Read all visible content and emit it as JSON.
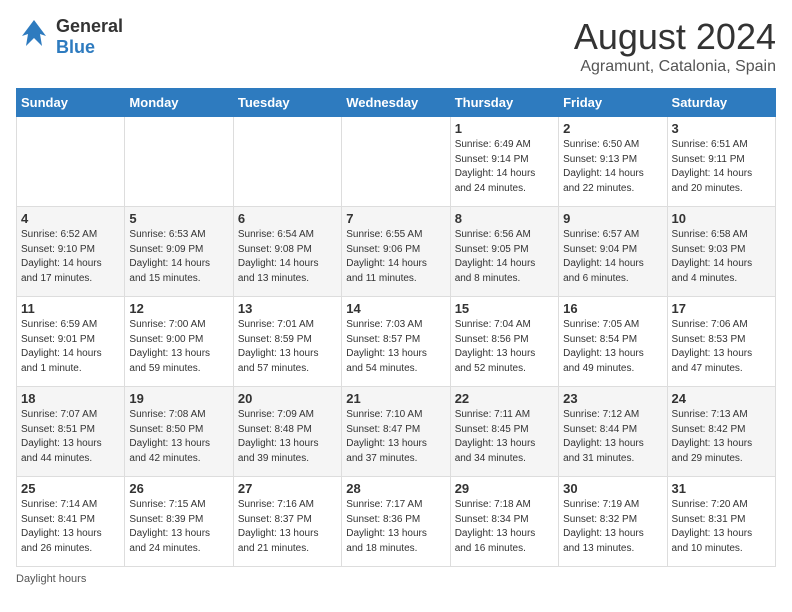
{
  "header": {
    "logo_general": "General",
    "logo_blue": "Blue",
    "title": "August 2024",
    "subtitle": "Agramunt, Catalonia, Spain"
  },
  "calendar": {
    "days_of_week": [
      "Sunday",
      "Monday",
      "Tuesday",
      "Wednesday",
      "Thursday",
      "Friday",
      "Saturday"
    ],
    "weeks": [
      [
        {
          "day": "",
          "info": ""
        },
        {
          "day": "",
          "info": ""
        },
        {
          "day": "",
          "info": ""
        },
        {
          "day": "",
          "info": ""
        },
        {
          "day": "1",
          "info": "Sunrise: 6:49 AM\nSunset: 9:14 PM\nDaylight: 14 hours\nand 24 minutes."
        },
        {
          "day": "2",
          "info": "Sunrise: 6:50 AM\nSunset: 9:13 PM\nDaylight: 14 hours\nand 22 minutes."
        },
        {
          "day": "3",
          "info": "Sunrise: 6:51 AM\nSunset: 9:11 PM\nDaylight: 14 hours\nand 20 minutes."
        }
      ],
      [
        {
          "day": "4",
          "info": "Sunrise: 6:52 AM\nSunset: 9:10 PM\nDaylight: 14 hours\nand 17 minutes."
        },
        {
          "day": "5",
          "info": "Sunrise: 6:53 AM\nSunset: 9:09 PM\nDaylight: 14 hours\nand 15 minutes."
        },
        {
          "day": "6",
          "info": "Sunrise: 6:54 AM\nSunset: 9:08 PM\nDaylight: 14 hours\nand 13 minutes."
        },
        {
          "day": "7",
          "info": "Sunrise: 6:55 AM\nSunset: 9:06 PM\nDaylight: 14 hours\nand 11 minutes."
        },
        {
          "day": "8",
          "info": "Sunrise: 6:56 AM\nSunset: 9:05 PM\nDaylight: 14 hours\nand 8 minutes."
        },
        {
          "day": "9",
          "info": "Sunrise: 6:57 AM\nSunset: 9:04 PM\nDaylight: 14 hours\nand 6 minutes."
        },
        {
          "day": "10",
          "info": "Sunrise: 6:58 AM\nSunset: 9:03 PM\nDaylight: 14 hours\nand 4 minutes."
        }
      ],
      [
        {
          "day": "11",
          "info": "Sunrise: 6:59 AM\nSunset: 9:01 PM\nDaylight: 14 hours\nand 1 minute."
        },
        {
          "day": "12",
          "info": "Sunrise: 7:00 AM\nSunset: 9:00 PM\nDaylight: 13 hours\nand 59 minutes."
        },
        {
          "day": "13",
          "info": "Sunrise: 7:01 AM\nSunset: 8:59 PM\nDaylight: 13 hours\nand 57 minutes."
        },
        {
          "day": "14",
          "info": "Sunrise: 7:03 AM\nSunset: 8:57 PM\nDaylight: 13 hours\nand 54 minutes."
        },
        {
          "day": "15",
          "info": "Sunrise: 7:04 AM\nSunset: 8:56 PM\nDaylight: 13 hours\nand 52 minutes."
        },
        {
          "day": "16",
          "info": "Sunrise: 7:05 AM\nSunset: 8:54 PM\nDaylight: 13 hours\nand 49 minutes."
        },
        {
          "day": "17",
          "info": "Sunrise: 7:06 AM\nSunset: 8:53 PM\nDaylight: 13 hours\nand 47 minutes."
        }
      ],
      [
        {
          "day": "18",
          "info": "Sunrise: 7:07 AM\nSunset: 8:51 PM\nDaylight: 13 hours\nand 44 minutes."
        },
        {
          "day": "19",
          "info": "Sunrise: 7:08 AM\nSunset: 8:50 PM\nDaylight: 13 hours\nand 42 minutes."
        },
        {
          "day": "20",
          "info": "Sunrise: 7:09 AM\nSunset: 8:48 PM\nDaylight: 13 hours\nand 39 minutes."
        },
        {
          "day": "21",
          "info": "Sunrise: 7:10 AM\nSunset: 8:47 PM\nDaylight: 13 hours\nand 37 minutes."
        },
        {
          "day": "22",
          "info": "Sunrise: 7:11 AM\nSunset: 8:45 PM\nDaylight: 13 hours\nand 34 minutes."
        },
        {
          "day": "23",
          "info": "Sunrise: 7:12 AM\nSunset: 8:44 PM\nDaylight: 13 hours\nand 31 minutes."
        },
        {
          "day": "24",
          "info": "Sunrise: 7:13 AM\nSunset: 8:42 PM\nDaylight: 13 hours\nand 29 minutes."
        }
      ],
      [
        {
          "day": "25",
          "info": "Sunrise: 7:14 AM\nSunset: 8:41 PM\nDaylight: 13 hours\nand 26 minutes."
        },
        {
          "day": "26",
          "info": "Sunrise: 7:15 AM\nSunset: 8:39 PM\nDaylight: 13 hours\nand 24 minutes."
        },
        {
          "day": "27",
          "info": "Sunrise: 7:16 AM\nSunset: 8:37 PM\nDaylight: 13 hours\nand 21 minutes."
        },
        {
          "day": "28",
          "info": "Sunrise: 7:17 AM\nSunset: 8:36 PM\nDaylight: 13 hours\nand 18 minutes."
        },
        {
          "day": "29",
          "info": "Sunrise: 7:18 AM\nSunset: 8:34 PM\nDaylight: 13 hours\nand 16 minutes."
        },
        {
          "day": "30",
          "info": "Sunrise: 7:19 AM\nSunset: 8:32 PM\nDaylight: 13 hours\nand 13 minutes."
        },
        {
          "day": "31",
          "info": "Sunrise: 7:20 AM\nSunset: 8:31 PM\nDaylight: 13 hours\nand 10 minutes."
        }
      ]
    ],
    "footer_note": "Daylight hours"
  }
}
